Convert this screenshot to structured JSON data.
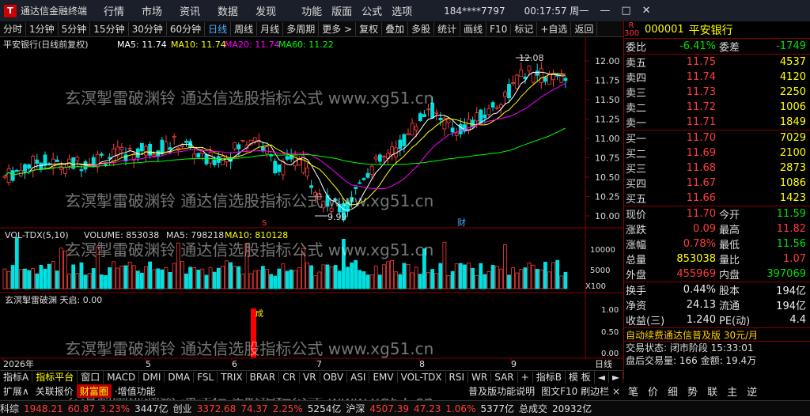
{
  "window": {
    "app_title": "通达信金融终端",
    "menu": [
      "行情",
      "市场",
      "资讯",
      "数据",
      "发现"
    ],
    "menu2": [
      "功能",
      "版面",
      "公式",
      "选项"
    ],
    "user": "184****7797",
    "clock": "00:17:57 周一"
  },
  "toolbar": {
    "items": [
      "分时",
      "1分钟",
      "5分钟",
      "15分钟",
      "30分钟",
      "60分钟",
      "日线",
      "周线",
      "月线",
      "多周期",
      "更多 >",
      "复权",
      "叠加",
      "多股",
      "统计",
      "画线",
      "F10",
      "标记",
      "+自选",
      "返回"
    ],
    "active": "日线"
  },
  "kline": {
    "title": "平安银行(日线前复权)",
    "ma_labels": [
      "MA5: 11.74",
      "MA10: 11.74",
      "MA20: 11.74",
      "MA60: 11.22"
    ],
    "ma_colors": [
      "#ffffff",
      "#ffff00",
      "#ff00ff",
      "#00ff00"
    ],
    "high_marker": "12.08",
    "low_marker": "9.99",
    "mark_s": "S",
    "mark_cai": "财",
    "y_ticks": [
      "12.00",
      "11.75",
      "11.50",
      "11.25",
      "11.00",
      "10.75",
      "10.50",
      "10.25",
      "10.00"
    ]
  },
  "volume": {
    "title": "VOL-TDX(5,10)",
    "volume_label": "VOLUME: 853038",
    "ma5_label": "MA5: 798218",
    "ma10_label": "MA10: 810128",
    "y_ticks": [
      "10000",
      "5000",
      "X100"
    ]
  },
  "indicator": {
    "title": "玄溟掣雷破渊 天启: 0.00",
    "signal_label": "成",
    "y_ticks": [
      "1.00",
      "0.50",
      "0.00"
    ]
  },
  "xaxis": {
    "labels": [
      "2026年",
      "5",
      "6",
      "7",
      "8",
      "9"
    ],
    "mode": "日线"
  },
  "quote": {
    "code": "000001",
    "name": "平安银行",
    "badge": "R 300",
    "weibi": {
      "label": "委比",
      "value": "-6.41%",
      "label2": "委差",
      "value2": "-1749"
    },
    "asks": [
      {
        "label": "卖五",
        "price": "11.75",
        "vol": "4537"
      },
      {
        "label": "卖四",
        "price": "11.74",
        "vol": "4120"
      },
      {
        "label": "卖三",
        "price": "11.73",
        "vol": "2250"
      },
      {
        "label": "卖二",
        "price": "11.72",
        "vol": "1006"
      },
      {
        "label": "卖一",
        "price": "11.71",
        "vol": "1849"
      }
    ],
    "bids": [
      {
        "label": "买一",
        "price": "11.70",
        "vol": "7029"
      },
      {
        "label": "买二",
        "price": "11.69",
        "vol": "2100"
      },
      {
        "label": "买三",
        "price": "11.68",
        "vol": "2873"
      },
      {
        "label": "买四",
        "price": "11.67",
        "vol": "1086"
      },
      {
        "label": "买五",
        "price": "11.66",
        "vol": "1423"
      }
    ],
    "stats": [
      {
        "l1": "现价",
        "v1": "11.70",
        "c1": "red",
        "l2": "今开",
        "v2": "11.59",
        "c2": "green"
      },
      {
        "l1": "涨跌",
        "v1": "0.09",
        "c1": "red",
        "l2": "最高",
        "v2": "11.82",
        "c2": "red"
      },
      {
        "l1": "涨幅",
        "v1": "0.78%",
        "c1": "red",
        "l2": "最低",
        "v2": "11.56",
        "c2": "green"
      },
      {
        "l1": "总量",
        "v1": "853038",
        "c1": "yellow",
        "l2": "量比",
        "v2": "1.07",
        "c2": "red"
      },
      {
        "l1": "外盘",
        "v1": "455969",
        "c1": "red",
        "l2": "内盘",
        "v2": "397069",
        "c2": "green"
      }
    ],
    "stats2": [
      {
        "l1": "换手",
        "v1": "0.44%",
        "l2": "股本",
        "v2": "194亿"
      },
      {
        "l1": "净资",
        "v1": "24.13",
        "l2": "流通",
        "v2": "194亿"
      },
      {
        "l1": "收益(三)",
        "v1": "1.240",
        "l2": "PE(动)",
        "v2": "4.4"
      }
    ],
    "ad": "自动续费通达信普及版 30元/月",
    "trade_status": "交易状态: 闭市阶段 15:33:01",
    "block_volume": "盘后交易量: 166 ",
    "block_amount": "金额: 19.4万"
  },
  "tabs1": {
    "items": [
      "指标A",
      "指标平台",
      "窗口",
      "MACD",
      "DMI",
      "DMA",
      "FSL",
      "TRIX",
      "BRAR",
      "CR",
      "VR",
      "OBV",
      "ASI",
      "EMV",
      "VOL-TDX",
      "RSI",
      "WR",
      "SAR",
      "+",
      "指标B",
      "模 板",
      "◄",
      "►"
    ],
    "active": "指标平台"
  },
  "tabs2": {
    "items": [
      "扩展∧",
      "关联报价",
      "财富圈",
      "·增值功能"
    ],
    "highlight": "财富圈",
    "promo": "普及版功能说明",
    "f10": "图文F10 刷边栏 ×"
  },
  "rtabs": [
    "笔",
    "价",
    "细",
    "势",
    "联",
    "主",
    "逆"
  ],
  "statusbar": [
    {
      "text": "科综",
      "c": "white"
    },
    {
      "text": "1948.21",
      "c": "red"
    },
    {
      "text": "60.87",
      "c": "red"
    },
    {
      "text": "3.23%",
      "c": "red"
    },
    {
      "text": "3447亿",
      "c": "white"
    },
    {
      "text": "创业",
      "c": "white"
    },
    {
      "text": "3372.68",
      "c": "red"
    },
    {
      "text": "74.37",
      "c": "red"
    },
    {
      "text": "2.25%",
      "c": "red"
    },
    {
      "text": "5254亿",
      "c": "white"
    },
    {
      "text": "沪深",
      "c": "white"
    },
    {
      "text": "4507.39",
      "c": "red"
    },
    {
      "text": "47.23",
      "c": "red"
    },
    {
      "text": "1.06%",
      "c": "red"
    },
    {
      "text": "5377亿",
      "c": "white"
    },
    {
      "text": "总成交",
      "c": "white"
    },
    {
      "text": "20932亿",
      "c": "white"
    }
  ],
  "watermark": "玄溟掣雷破渊铃 通达信选股指标公式 www.xg51.cn"
}
